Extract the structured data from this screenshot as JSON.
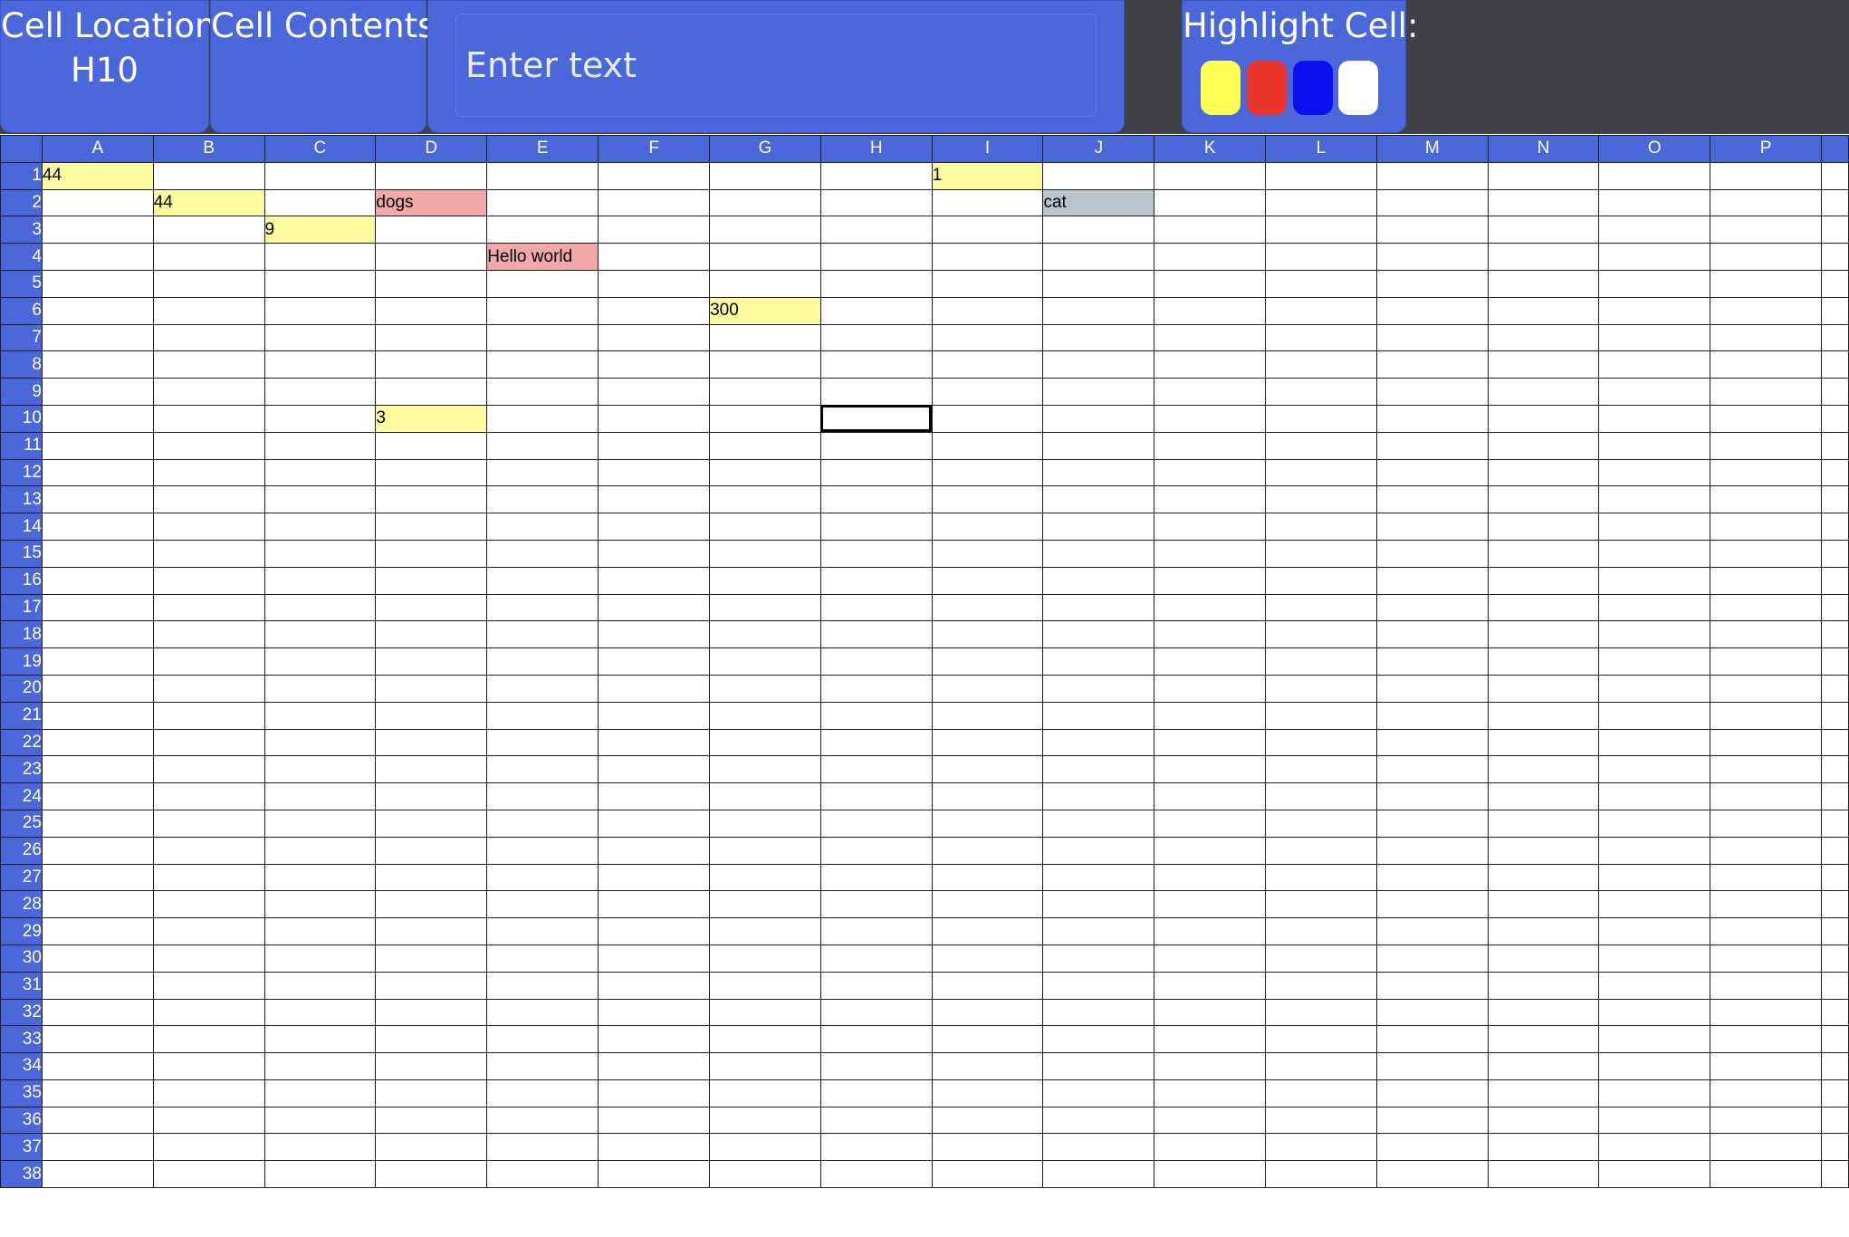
{
  "header": {
    "cell_location": {
      "title": "Cell Location",
      "value": "H10"
    },
    "cell_contents": {
      "title": "Cell Contents"
    },
    "text_input": {
      "placeholder": "Enter text",
      "value": ""
    },
    "highlight": {
      "title": "Highlight Cell:",
      "swatches": [
        {
          "name": "yellow",
          "color": "#ffff55"
        },
        {
          "name": "red",
          "color": "#e8342a"
        },
        {
          "name": "blue",
          "color": "#0b10f0"
        },
        {
          "name": "white",
          "color": "#ffffff"
        }
      ]
    }
  },
  "sheet": {
    "columns": [
      "A",
      "B",
      "C",
      "D",
      "E",
      "F",
      "G",
      "H",
      "I",
      "J",
      "K",
      "L",
      "M",
      "N",
      "O",
      "P"
    ],
    "row_count": 38,
    "selected": "H10",
    "highlight_colors": {
      "yellow": "#fdfaa0",
      "red": "#f0a8a8",
      "gray": "#b8c5cf"
    },
    "cells": [
      {
        "ref": "A1",
        "value": "44",
        "highlight": "yellow"
      },
      {
        "ref": "I1",
        "value": "1",
        "highlight": "yellow"
      },
      {
        "ref": "B2",
        "value": "44",
        "highlight": "yellow"
      },
      {
        "ref": "D2",
        "value": "dogs",
        "highlight": "red"
      },
      {
        "ref": "J2",
        "value": "cat",
        "highlight": "gray"
      },
      {
        "ref": "C3",
        "value": "9",
        "highlight": "yellow"
      },
      {
        "ref": "E4",
        "value": "Hello world",
        "highlight": "red"
      },
      {
        "ref": "G6",
        "value": "300",
        "highlight": "yellow"
      },
      {
        "ref": "D10",
        "value": "3",
        "highlight": "yellow"
      }
    ]
  }
}
